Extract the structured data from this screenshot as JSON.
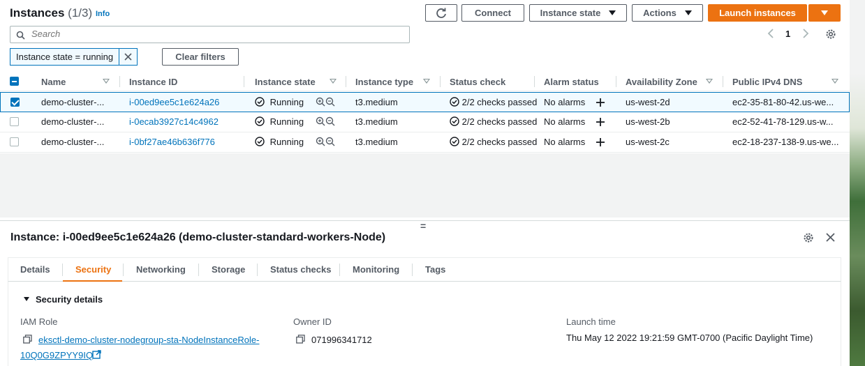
{
  "header": {
    "title": "Instances",
    "count": "(1/3)",
    "info": "Info",
    "connect": "Connect",
    "instance_state": "Instance state",
    "actions": "Actions",
    "launch": "Launch instances"
  },
  "search": {
    "placeholder": "Search"
  },
  "pager": {
    "page": "1"
  },
  "filter": {
    "chip": "Instance state = running",
    "clear": "Clear filters"
  },
  "table": {
    "columns": [
      "Name",
      "Instance ID",
      "Instance state",
      "Instance type",
      "Status check",
      "Alarm status",
      "Availability Zone",
      "Public IPv4 DNS"
    ],
    "rows": [
      {
        "name": "demo-cluster-...",
        "id": "i-00ed9ee5c1e624a26",
        "state": "Running",
        "type": "t3.medium",
        "status": "2/2 checks passed",
        "alarm": "No alarms",
        "az": "us-west-2d",
        "dns": "ec2-35-81-80-42.us-we...",
        "selected": true
      },
      {
        "name": "demo-cluster-...",
        "id": "i-0ecab3927c14c4962",
        "state": "Running",
        "type": "t3.medium",
        "status": "2/2 checks passed",
        "alarm": "No alarms",
        "az": "us-west-2b",
        "dns": "ec2-52-41-78-129.us-w...",
        "selected": false
      },
      {
        "name": "demo-cluster-...",
        "id": "i-0bf27ae46b636f776",
        "state": "Running",
        "type": "t3.medium",
        "status": "2/2 checks passed",
        "alarm": "No alarms",
        "az": "us-west-2c",
        "dns": "ec2-18-237-138-9.us-we...",
        "selected": false
      }
    ]
  },
  "detail": {
    "title": "Instance: i-00ed9ee5c1e624a26 (demo-cluster-standard-workers-Node)",
    "tabs": [
      "Details",
      "Security",
      "Networking",
      "Storage",
      "Status checks",
      "Monitoring",
      "Tags"
    ],
    "active_tab": "Security",
    "section": "Security details",
    "iam_label": "IAM Role",
    "iam_value_1": "eksctl-demo-cluster-nodegroup-sta-NodeInstanceRole-",
    "iam_value_2": "10Q0G9ZPYY9IQ",
    "owner_label": "Owner ID",
    "owner_value": "071996341712",
    "launch_label": "Launch time",
    "launch_value": "Thu May 12 2022 19:21:59 GMT-0700 (Pacific Daylight Time)"
  },
  "colors": {
    "accent": "#ec7211",
    "link": "#0073bb",
    "success": "#1d8102"
  }
}
